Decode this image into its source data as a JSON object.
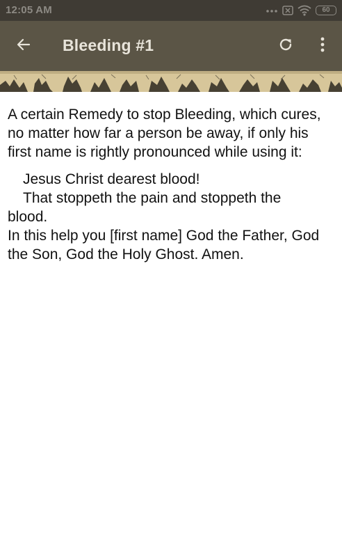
{
  "status_bar": {
    "time": "12:05 AM",
    "battery_level": "60",
    "icons": [
      "more-dots-icon",
      "no-sim-icon",
      "wifi-icon",
      "battery-icon"
    ]
  },
  "app_bar": {
    "title": "Bleeding #1",
    "background_color": "#5b5546",
    "icons": [
      "arrow-back-icon",
      "refresh-icon",
      "more-vert-icon"
    ]
  },
  "banner": {
    "description_icon": "engraving-banner-image"
  },
  "content": {
    "intro": "A certain Remedy to stop Bleeding, which cures, no matter how far a person be away, if only his first name is rightly pronounced while using it:",
    "line1": "Jesus Christ dearest blood!",
    "line2": "That stoppeth the pain and stoppeth the",
    "line2_cont": "blood.",
    "line3": "In this help you [first name] God the Father, God the Son, God the Holy Ghost. Amen."
  }
}
